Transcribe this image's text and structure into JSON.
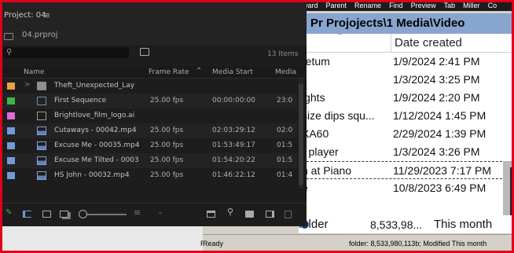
{
  "colors": {
    "accent_red": "#e0001b",
    "path_bar": "#88a5cf",
    "label_orange": "#e8a33c",
    "label_green": "#3cb54a",
    "label_violet": "#e06ad6",
    "label_blue": "#6f9bd8"
  },
  "explorer": {
    "menu": [
      "ward",
      "Parent",
      "Rename",
      "Find",
      "Preview",
      "Tab",
      "Miller",
      "Co"
    ],
    "path": "Pr Projojects\\1  Media\\Video",
    "column_date": "Date created",
    "files": [
      {
        "name": "retum",
        "date": "1/9/2024 2:41 PM"
      },
      {
        "name": "",
        "date": "1/3/2024 3:25 PM"
      },
      {
        "name": "ights",
        "date": "1/9/2024 2:20 PM"
      },
      {
        "name": "size dips squ...",
        "date": "1/12/2024 1:45 PM"
      },
      {
        "name": "XA60",
        "date": "2/29/2024 1:39 PM"
      },
      {
        "name": "r player",
        "date": "1/3/2024 3:26 PM"
      },
      {
        "name": "h at Piano",
        "date": "11/29/2023 7:17 PM"
      },
      {
        "name": "e",
        "date": "10/8/2023 6:49 PM"
      }
    ],
    "summary": {
      "name": "The folder",
      "size": "8,533,98...",
      "modified": "This month"
    },
    "status": {
      "ready": "Ready",
      "info": "folder: 8,533,980,113b; Modified This month"
    }
  },
  "premiere": {
    "tab_title": "Project: 04",
    "menu_icon": "hamburger-menu-icon",
    "project_name": "04.prproj",
    "search_placeholder": "",
    "items_count": "13 Items",
    "columns": {
      "name": "Name",
      "frame_rate": "Frame Rate",
      "media_start": "Media Start",
      "media_end": "Media"
    },
    "items": [
      {
        "label_color": "orange",
        "icon": "folder-icon",
        "twirl": ">",
        "name": "Theft_Unexpected_Lay",
        "fps": "",
        "start": "",
        "end": ""
      },
      {
        "label_color": "green",
        "icon": "sequence-icon",
        "twirl": "",
        "name": "First Sequence",
        "fps": "25.00 fps",
        "start": "00:00:00:00",
        "end": "23:0"
      },
      {
        "label_color": "violet",
        "icon": "image-icon",
        "twirl": "",
        "name": "Brightlove_film_logo.ai",
        "fps": "",
        "start": "",
        "end": ""
      },
      {
        "label_color": "blue",
        "icon": "clip-icon",
        "twirl": "",
        "name": "Cutaways - 00042.mp4",
        "fps": "25.00 fps",
        "start": "02:03:29:12",
        "end": "02:0"
      },
      {
        "label_color": "blue",
        "icon": "clip-icon",
        "twirl": "",
        "name": "Excuse Me - 00035.mp4",
        "fps": "25.00 fps",
        "start": "01:53:49:17",
        "end": "01:5"
      },
      {
        "label_color": "blue",
        "icon": "clip-icon",
        "twirl": "",
        "name": "Excuse Me Tilted - 0003",
        "fps": "25.00 fps",
        "start": "01:54:20:22",
        "end": "01:5"
      },
      {
        "label_color": "blue",
        "icon": "clip-icon",
        "twirl": "",
        "name": "HS John - 00032.mp4",
        "fps": "25.00 fps",
        "start": "01:46:22:12",
        "end": "01:4"
      }
    ]
  }
}
